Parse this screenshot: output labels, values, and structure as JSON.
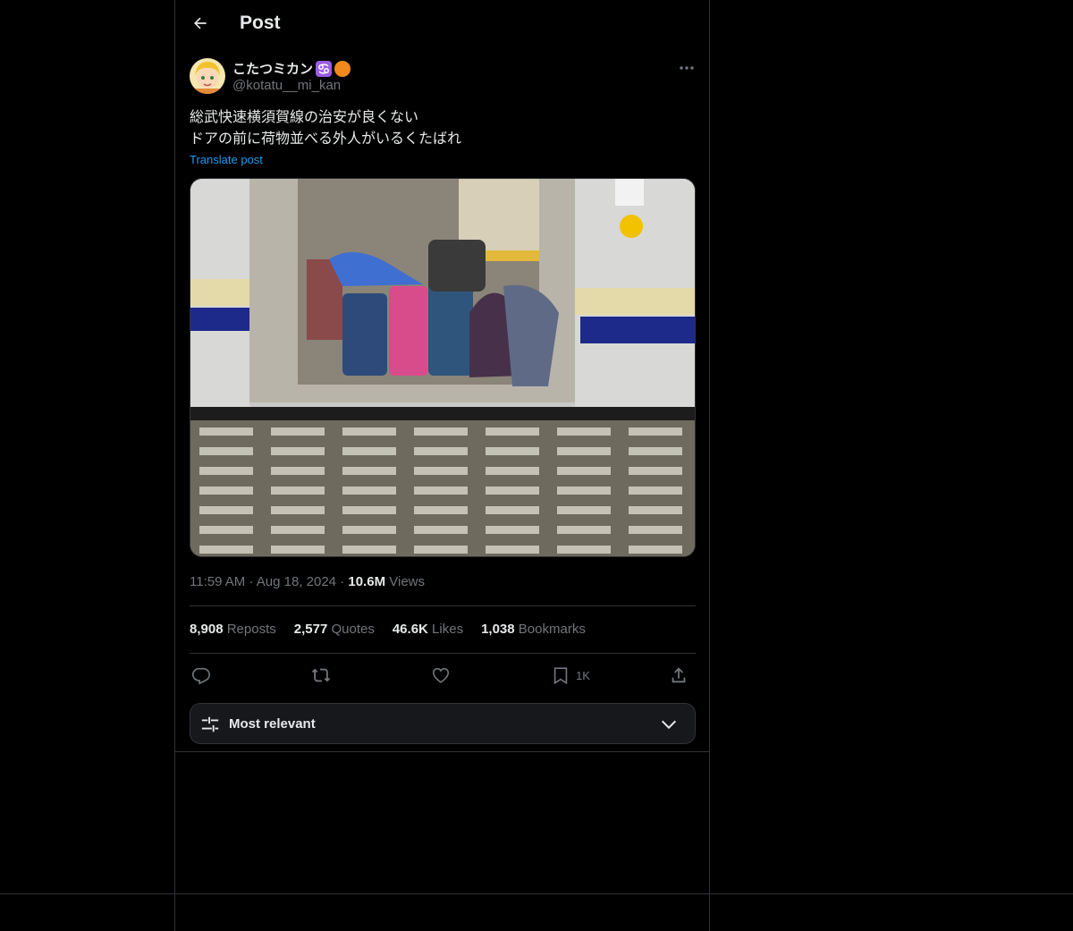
{
  "header": {
    "title": "Post"
  },
  "post": {
    "display_name": "こたつミカン",
    "handle": "@kotatu__mi_kan",
    "text_line1": "総武快速横須賀線の治安が良くない",
    "text_line2": "ドアの前に荷物並べる外人がいるくたばれ",
    "translate_label": "Translate post",
    "time": "11:59 AM",
    "date": "Aug 18, 2024",
    "views_count": "10.6M",
    "views_label": "Views",
    "sep": "·"
  },
  "stats": [
    {
      "count": "8,908",
      "label": "Reposts"
    },
    {
      "count": "2,577",
      "label": "Quotes"
    },
    {
      "count": "46.6K",
      "label": "Likes"
    },
    {
      "count": "1,038",
      "label": "Bookmarks"
    }
  ],
  "actions": {
    "bookmark_count": "1K"
  },
  "sort": {
    "label": "Most relevant"
  },
  "icons": [
    "back-arrow-icon",
    "more-icon",
    "reply-icon",
    "repost-icon",
    "like-icon",
    "bookmark-icon",
    "share-icon",
    "sliders-icon",
    "chevron-down-icon"
  ]
}
